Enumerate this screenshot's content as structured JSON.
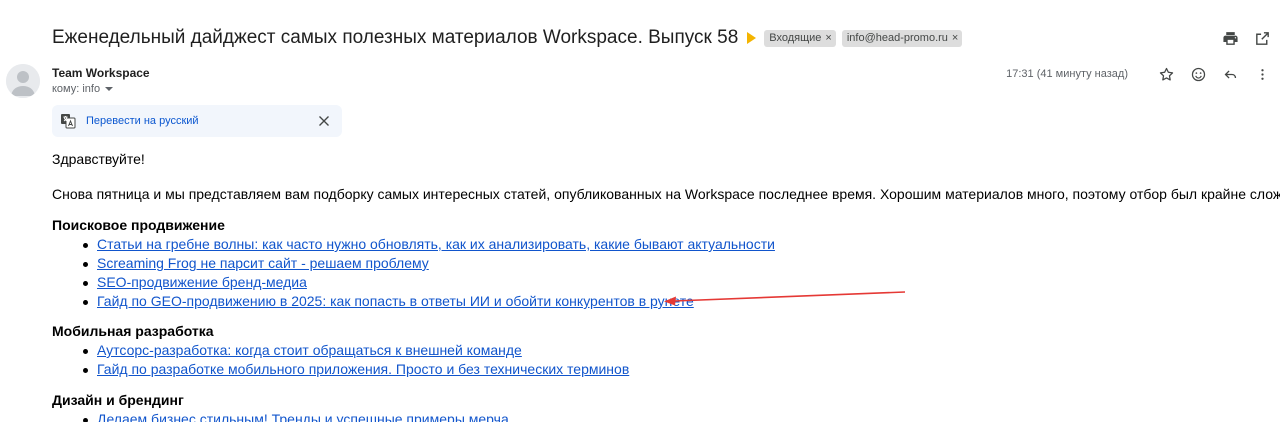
{
  "header": {
    "subject": "Еженедельный дайджест самых полезных материалов Workspace. Выпуск 58",
    "labels": [
      {
        "name": "Входящие"
      },
      {
        "name": "info@head-promo.ru"
      }
    ],
    "label_close_glyph": "×"
  },
  "sender": {
    "name": "Team Workspace",
    "recipient": "кому: info",
    "time": "17:31 (41 минуту назад)"
  },
  "translate": {
    "link": "Перевести на русский"
  },
  "body": {
    "greeting": "Здравствуйте!",
    "intro": "Снова пятница и мы представляем вам подборку самых интересных статей, опубликованных на Workspace последнее время. Хорошим материалов много, поэтому отбор был крайне сложным.",
    "sections": [
      {
        "title": "Поисковое продвижение",
        "links": [
          "Статьи на гребне волны: как часто нужно обновлять, как их анализировать, какие бывают актуальности",
          "Screaming Frog не парсит сайт - решаем проблему",
          "SEO-продвижение бренд-медиа",
          "Гайд по GEO-продвижению в 2025: как попасть в ответы ИИ и обойти конкурентов в рунете"
        ]
      },
      {
        "title": "Мобильная разработка",
        "links": [
          "Аутсорс-разработка: когда стоит обращаться к внешней команде",
          "Гайд по разработке мобильного приложения. Просто и без технических терминов"
        ]
      },
      {
        "title": "Дизайн и брендинг",
        "links": [
          "Делаем бизнес стильным! Тренды и успешные примеры мерча"
        ]
      }
    ]
  },
  "annotation": {
    "arrow_color": "#e53935"
  },
  "icons": {
    "print": "print-icon",
    "open_new_window": "open-in-new-window-icon",
    "star": "star-icon",
    "emoji": "emoji-icon",
    "reply": "reply-icon",
    "more": "more-vert-icon",
    "translate": "translate-icon",
    "close": "close-icon"
  },
  "colors": {
    "link": "#1155cc",
    "importance": "#f4b400",
    "chip_bg": "#dddddd",
    "translate_bg": "#f2f6fc"
  }
}
